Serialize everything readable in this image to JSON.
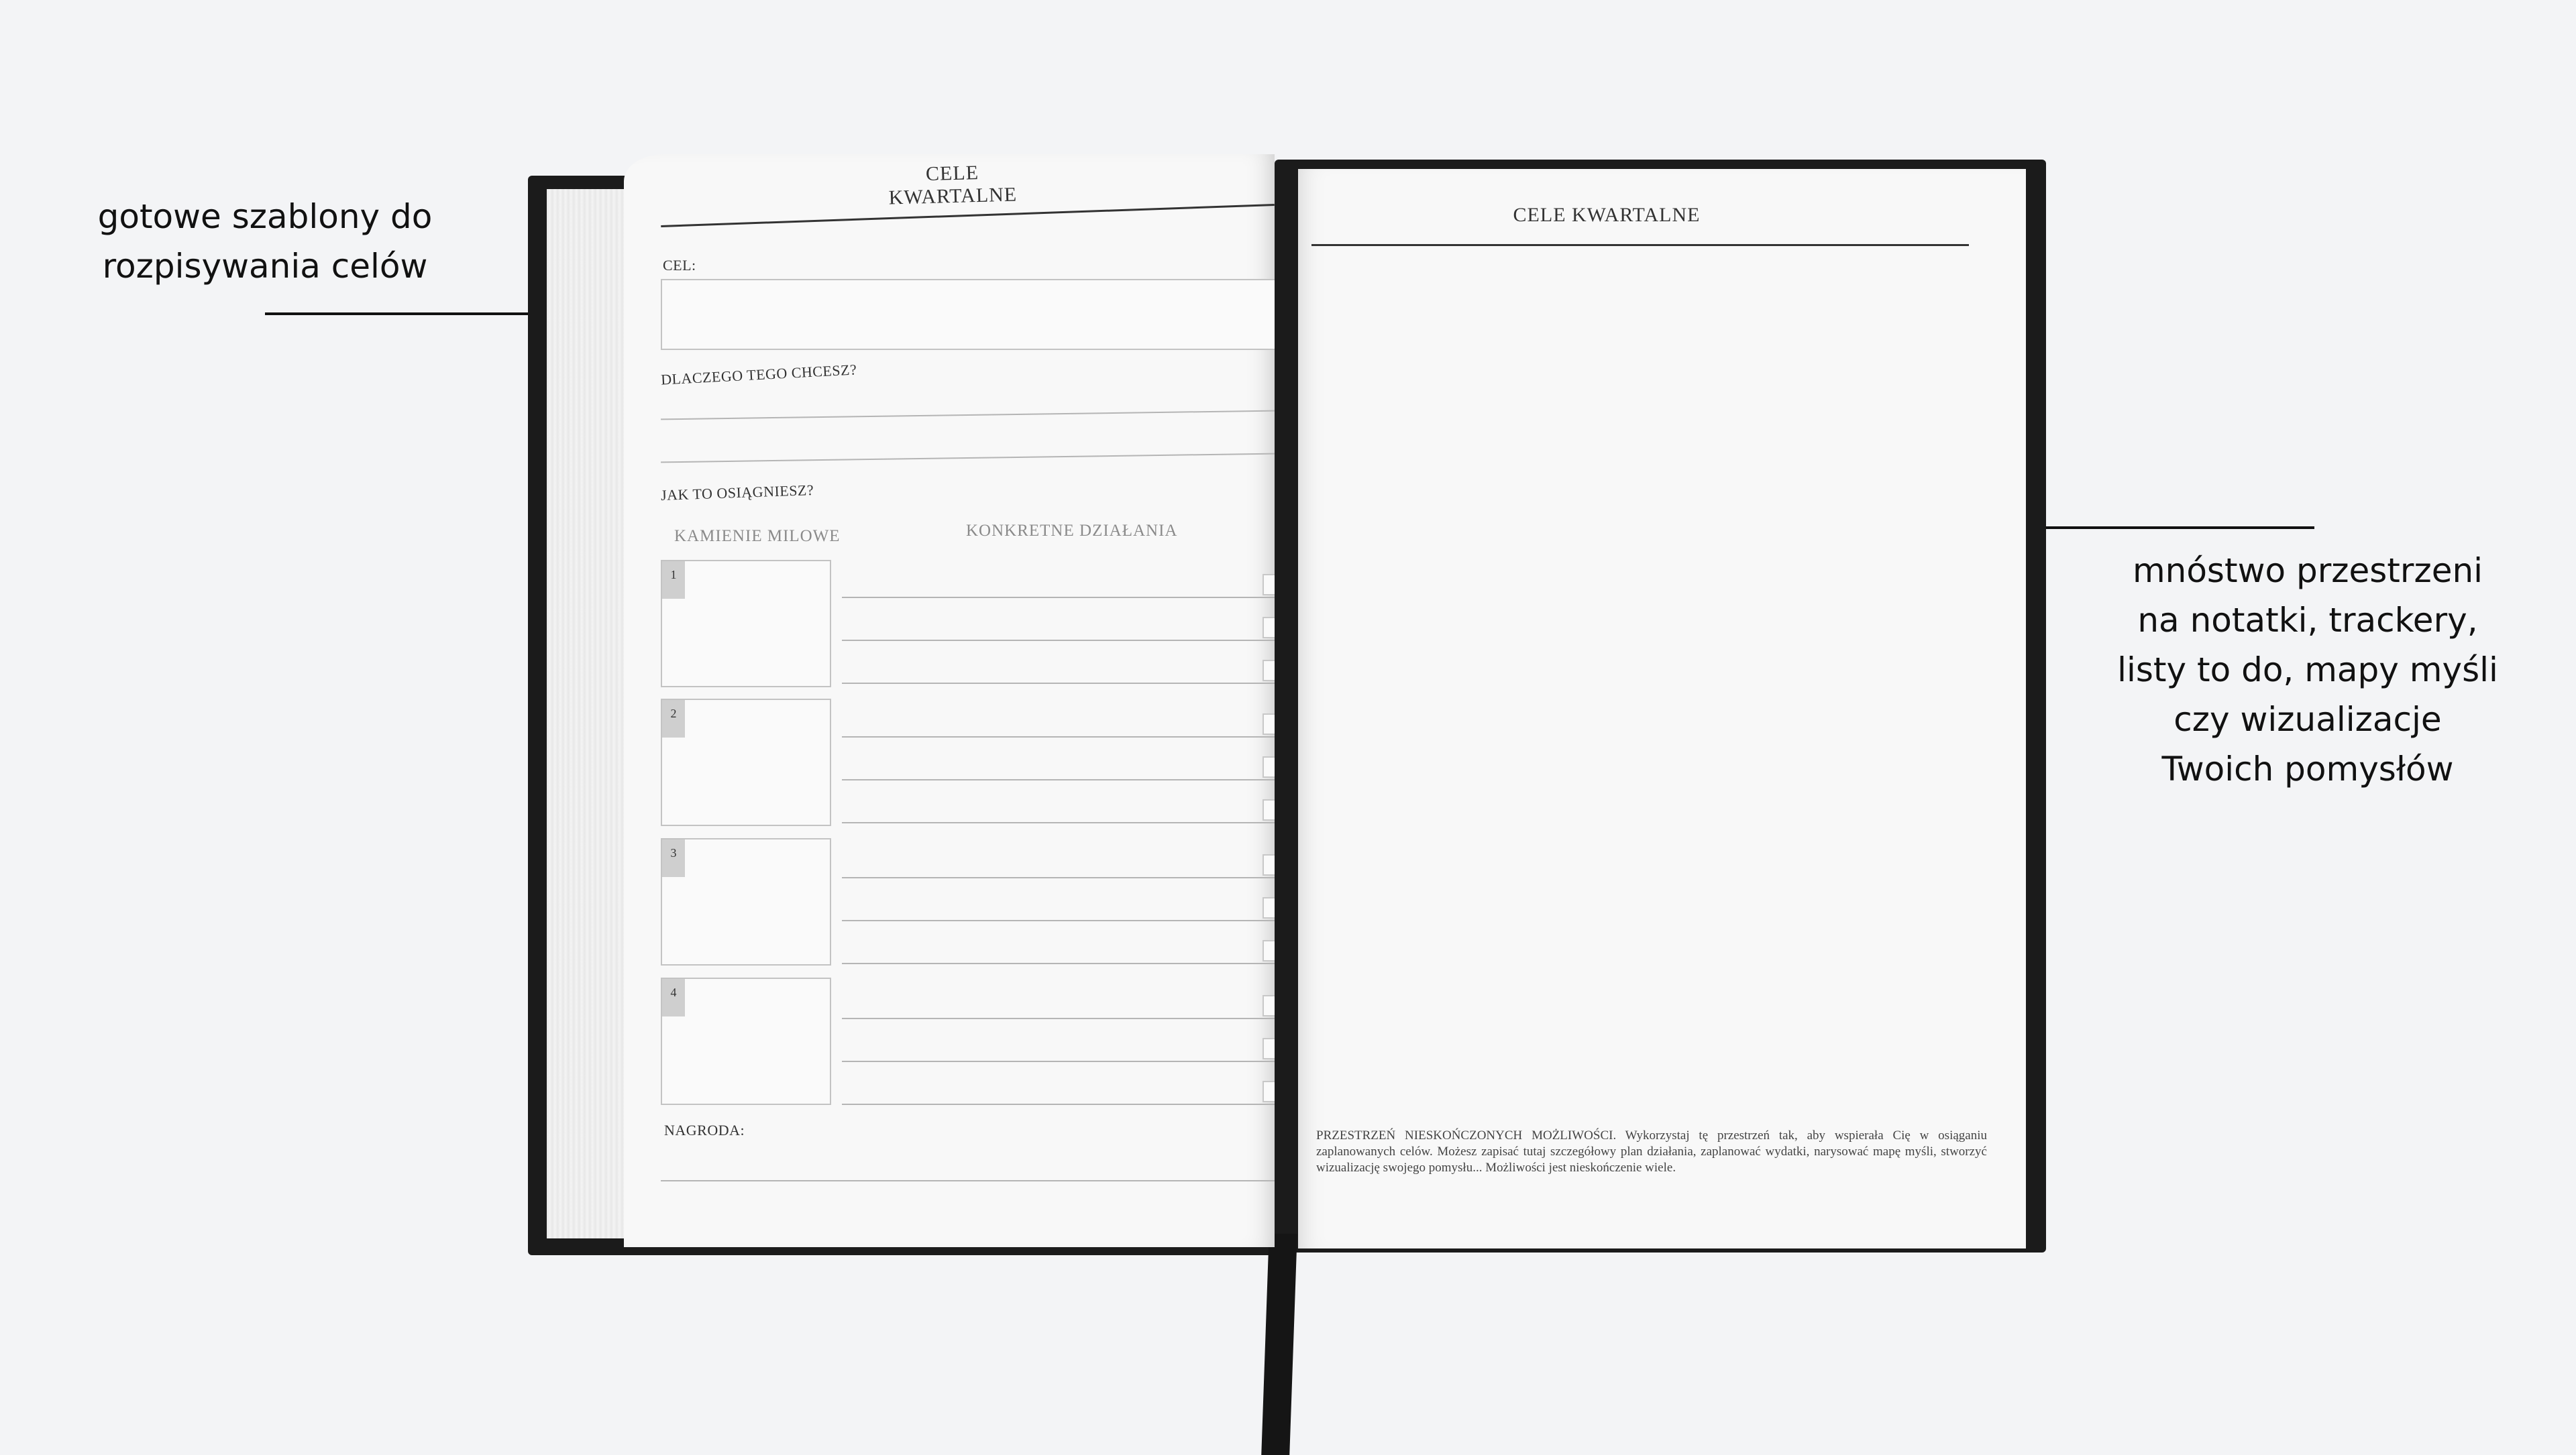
{
  "annotations": {
    "left": "gotowe szablony do\nrozpisywania celów",
    "right": "mnóstwo przestrzeni\nna notatki, trackery,\nlisty to do, mapy myśli\n czy wizualizacje\nTwoich pomysłów"
  },
  "left_page": {
    "title": "CELE KWARTALNE",
    "goal_label": "CEL:",
    "why_label": "DLACZEGO TEGO CHCESZ?",
    "how_label": "JAK TO OSIĄGNIESZ?",
    "milestones_header": "KAMIENIE MILOWE",
    "actions_header": "KONKRETNE DZIAŁANIA",
    "milestones": [
      "1",
      "2",
      "3",
      "4"
    ],
    "reward_label": "NAGRODA:"
  },
  "right_page": {
    "title": "CELE KWARTALNE",
    "footnote": "PRZESTRZEŃ NIESKOŃCZONYCH MOŻLIWOŚCI. Wykorzystaj tę przestrzeń tak, aby wspierała Cię w osiąganiu zaplanowanych celów. Możesz zapisać tutaj szczegółowy plan działania, zaplanować wydatki, narysować mapę myśli, stworzyć wizualizację swojego pomysłu... Możliwości jest nieskończenie wiele."
  }
}
